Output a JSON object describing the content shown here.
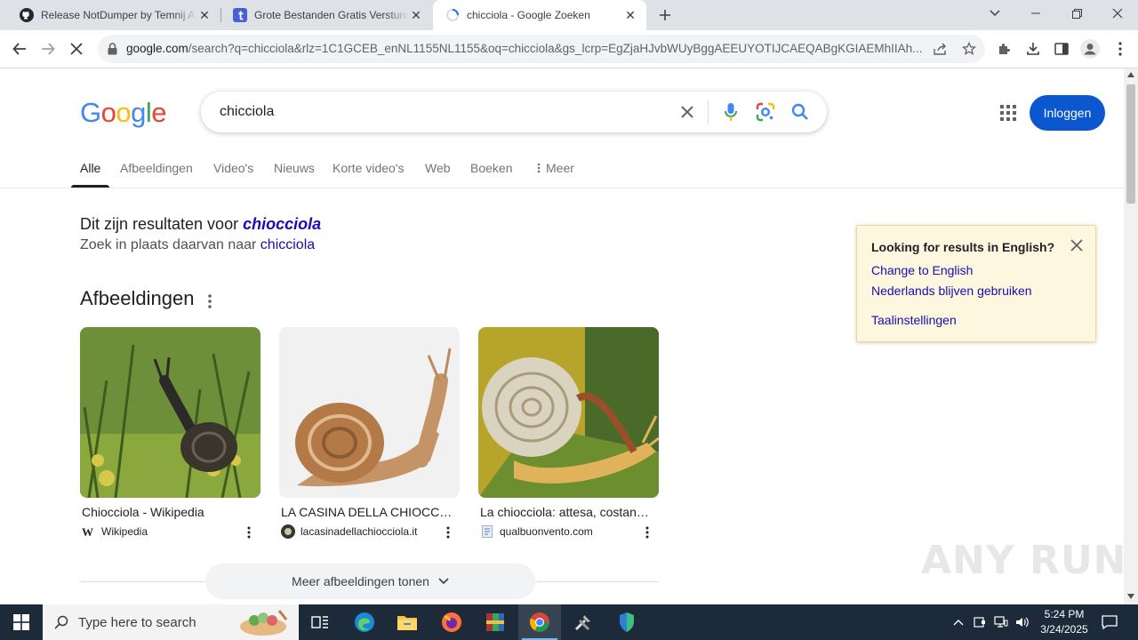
{
  "tabs": [
    {
      "title": "Release NotDumper by Temnij A",
      "icon": "github-icon"
    },
    {
      "title": "Grote Bestanden Gratis Versturen",
      "icon": "transfer-icon"
    },
    {
      "title": "chicciola - Google Zoeken",
      "icon": "google-icon",
      "active": true
    }
  ],
  "omnibox": {
    "host": "google.com",
    "path": "/search?q=chicciola&rlz=1C1GCEB_enNL1155NL1155&oq=chicciola&gs_lcrp=EgZjaHJvbWUyBggAEEUYOTIJCAEQABgKGIAEMhIIAh..."
  },
  "google": {
    "logo_letters": [
      "G",
      "o",
      "o",
      "g",
      "l",
      "e"
    ],
    "logo_colors": [
      "#4285f4",
      "#ea4335",
      "#fbbc05",
      "#4285f4",
      "#34a853",
      "#ea4335"
    ],
    "query": "chicciola",
    "login_label": "Inloggen",
    "nav": [
      "Alle",
      "Afbeeldingen",
      "Video's",
      "Nieuws",
      "Korte video's",
      "Web",
      "Boeken",
      "Meer"
    ],
    "spell": {
      "prefix": "Dit zijn resultaten voor ",
      "corrected": "chiocciola",
      "alt_prefix": "Zoek in plaats daarvan naar ",
      "alt_link": "chicciola"
    },
    "images_heading": "Afbeeldingen",
    "images": [
      {
        "title": "Chiocciola - Wikipedia",
        "source": "Wikipedia"
      },
      {
        "title": "LA CASINA DELLA CHIOCCIOLA",
        "source": "lacasinadellachiocciola.it"
      },
      {
        "title": "La chiocciola: attesa, costanza e lentezza",
        "source": "qualbuonvento.com"
      }
    ],
    "more_images_label": "Meer afbeeldingen tonen",
    "lang_popup": {
      "title": "Looking for results in English?",
      "link1": "Change to English",
      "link2": "Nederlands blijven gebruiken",
      "link3": "Taalinstellingen"
    }
  },
  "watermark": "ANY RUN",
  "taskbar": {
    "search_placeholder": "Type here to search",
    "time": "5:24 PM",
    "date": "3/24/2025"
  }
}
